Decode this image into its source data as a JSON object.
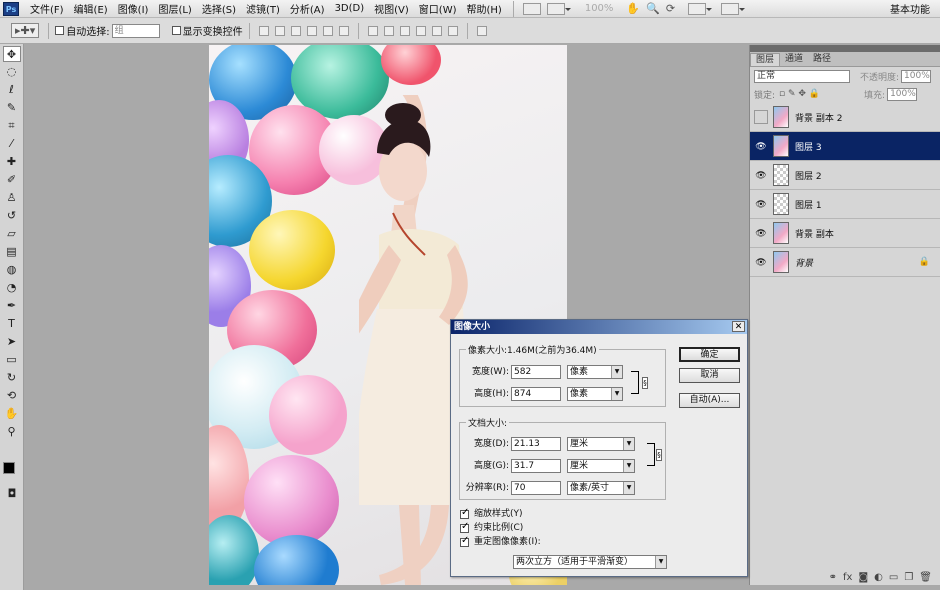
{
  "menubar": {
    "logo": "Ps",
    "items": [
      "文件(F)",
      "编辑(E)",
      "图像(I)",
      "图层(L)",
      "选择(S)",
      "滤镜(T)",
      "分析(A)",
      "3D(D)",
      "视图(V)",
      "窗口(W)",
      "帮助(H)"
    ],
    "zoom": "100%",
    "workspace": "基本功能"
  },
  "options": {
    "auto_select_label": "自动选择:",
    "auto_select_value": "组",
    "show_transform_label": "显示变换控件"
  },
  "tools": [
    "move",
    "marquee",
    "lasso",
    "quick-select",
    "crop",
    "eyedropper",
    "healing",
    "brush",
    "stamp",
    "history-brush",
    "eraser",
    "gradient",
    "blur",
    "dodge",
    "pen",
    "type",
    "path-select",
    "shape",
    "3d-rotate",
    "3d-orbit",
    "hand",
    "zoom"
  ],
  "layers": {
    "tabs": [
      "图层",
      "通道",
      "路径"
    ],
    "blend_mode": "正常",
    "opacity_label": "不透明度:",
    "opacity": "100%",
    "lock_label": "锁定:",
    "fill_label": "填充:",
    "fill": "100%",
    "items": [
      {
        "name": "背景 副本 2",
        "visible": false,
        "thumb": "photo",
        "selected": false,
        "locked": false
      },
      {
        "name": "图层 3",
        "visible": true,
        "thumb": "photo",
        "selected": true,
        "locked": false
      },
      {
        "name": "图层 2",
        "visible": true,
        "thumb": "trans",
        "selected": false,
        "locked": false
      },
      {
        "name": "图层 1",
        "visible": true,
        "thumb": "trans",
        "selected": false,
        "locked": false
      },
      {
        "name": "背景 副本",
        "visible": true,
        "thumb": "photo",
        "selected": false,
        "locked": false
      },
      {
        "name": "背景",
        "visible": true,
        "thumb": "photo",
        "selected": false,
        "locked": true
      }
    ]
  },
  "dialog": {
    "title": "图像大小",
    "close": "✕",
    "pixel_legend": "像素大小:1.46M(之前为36.4M)",
    "width_label": "宽度(W):",
    "width_value": "582",
    "width_unit": "像素",
    "height_label": "高度(H):",
    "height_value": "874",
    "height_unit": "像素",
    "doc_legend": "文档大小:",
    "doc_width_label": "宽度(D):",
    "doc_width_value": "21.13",
    "doc_width_unit": "厘米",
    "doc_height_label": "高度(G):",
    "doc_height_value": "31.7",
    "doc_height_unit": "厘米",
    "resolution_label": "分辨率(R):",
    "resolution_value": "70",
    "resolution_unit": "像素/英寸",
    "ok": "确定",
    "cancel": "取消",
    "auto": "自动(A)...",
    "scale_styles": "缩放样式(Y)",
    "constrain": "约束比例(C)",
    "resample": "重定图像像素(I):",
    "resample_method": "两次立方（适用于平滑渐变）"
  }
}
